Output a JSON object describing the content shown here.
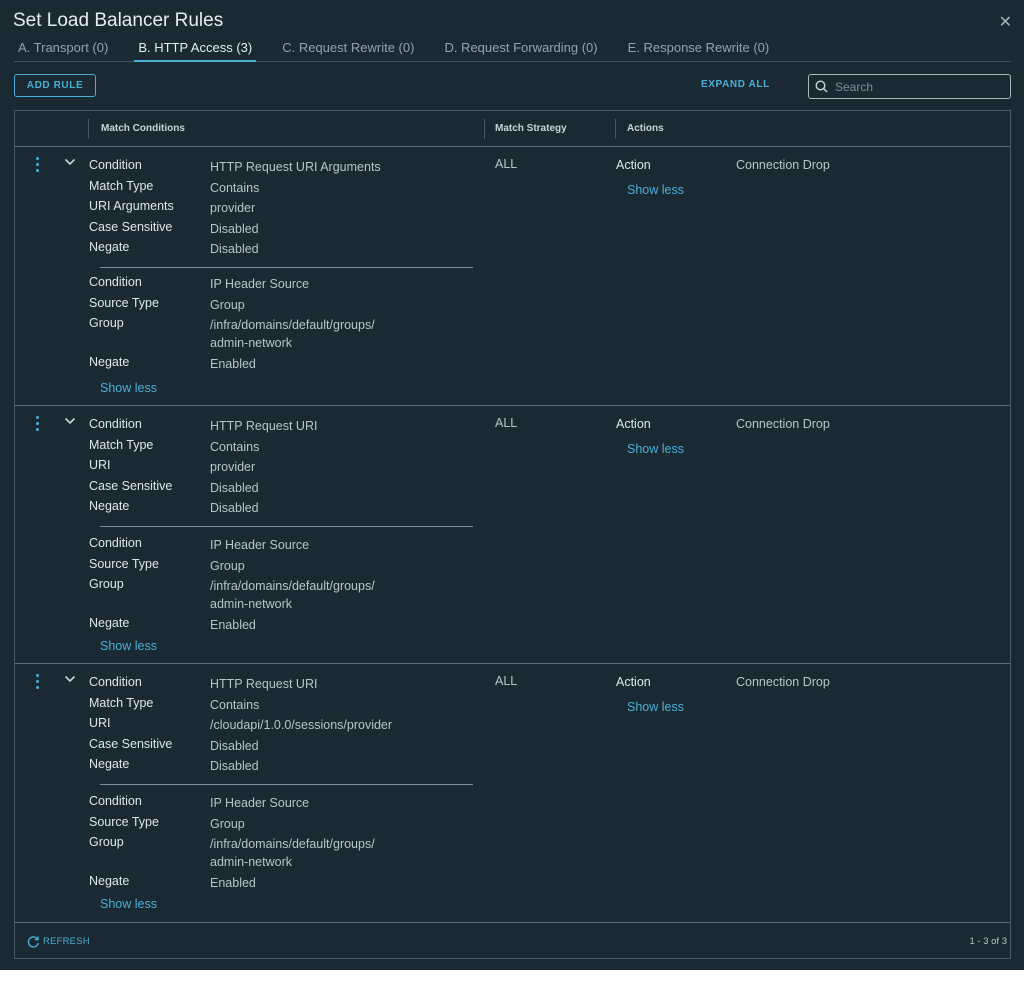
{
  "dialog": {
    "title": "Set Load Balancer Rules",
    "close_icon": "close-icon"
  },
  "tabs": [
    {
      "label": "A. Transport (0)",
      "active": false
    },
    {
      "label": "B. HTTP Access (3)",
      "active": true
    },
    {
      "label": "C. Request Rewrite (0)",
      "active": false
    },
    {
      "label": "D. Request Forwarding (0)",
      "active": false
    },
    {
      "label": "E. Response Rewrite (0)",
      "active": false
    }
  ],
  "toolbar": {
    "add_rule_label": "ADD RULE",
    "expand_all_label": "EXPAND ALL",
    "search_placeholder": "Search"
  },
  "grid": {
    "columns": {
      "match_conditions": "Match Conditions",
      "match_strategy": "Match Strategy",
      "actions": "Actions"
    },
    "rows": [
      {
        "c1": {
          "condition": "HTTP Request URI Arguments",
          "match_type": "Contains",
          "third_key": "URI Arguments",
          "third_val": "provider",
          "case_sensitive": "Disabled",
          "negate": "Disabled"
        },
        "c2": {
          "condition": "IP Header Source",
          "source_type": "Group",
          "group_line1": "/infra/domains/default/groups/",
          "group_line2": "admin-network",
          "negate": "Enabled"
        },
        "strategy": "ALL",
        "action": "Connection Drop"
      },
      {
        "c1": {
          "condition": "HTTP Request URI",
          "match_type": "Contains",
          "third_key": "URI",
          "third_val": "provider",
          "case_sensitive": "Disabled",
          "negate": "Disabled"
        },
        "c2": {
          "condition": "IP Header Source",
          "source_type": "Group",
          "group_line1": "/infra/domains/default/groups/",
          "group_line2": "admin-network",
          "negate": "Enabled"
        },
        "strategy": "ALL",
        "action": "Connection Drop"
      },
      {
        "c1": {
          "condition": "HTTP Request URI",
          "match_type": "Contains",
          "third_key": "URI",
          "third_val": "/cloudapi/1.0.0/sessions/provider",
          "case_sensitive": "Disabled",
          "negate": "Disabled"
        },
        "c2": {
          "condition": "IP Header Source",
          "source_type": "Group",
          "group_line1": "/infra/domains/default/groups/",
          "group_line2": "admin-network",
          "negate": "Enabled"
        },
        "strategy": "ALL",
        "action": "Connection Drop"
      }
    ]
  },
  "labels": {
    "condition": "Condition",
    "match_type": "Match Type",
    "case_sensitive": "Case Sensitive",
    "negate": "Negate",
    "source_type": "Source Type",
    "group": "Group",
    "action": "Action",
    "show_less": "Show less"
  },
  "footer": {
    "refresh_label": "REFRESH",
    "pagination": "1 - 3 of 3"
  },
  "colors": {
    "background": "#1b2a32",
    "accent": "#49afd9"
  }
}
